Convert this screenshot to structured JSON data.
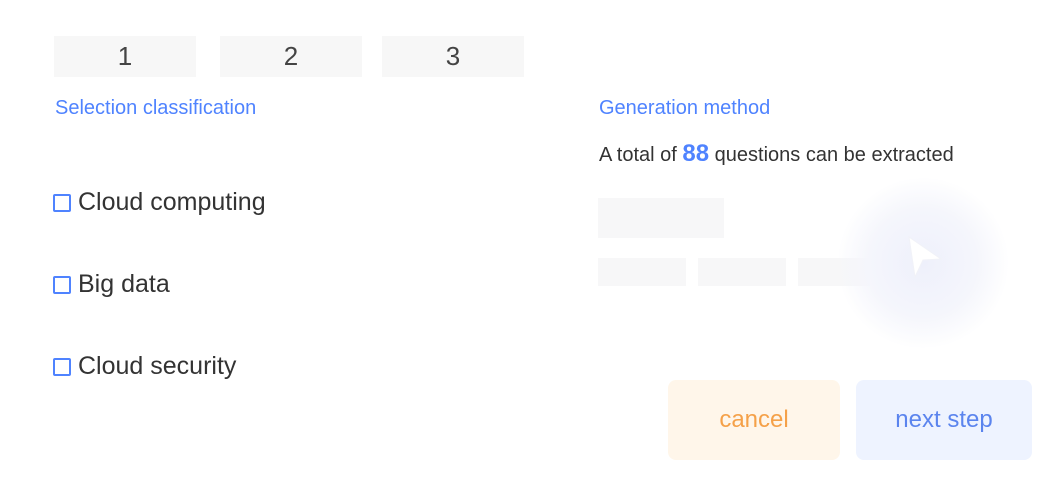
{
  "steps": [
    "1",
    "2",
    "3"
  ],
  "left_panel": {
    "title": "Selection classification",
    "categories": [
      {
        "label": "Cloud computing",
        "checked": false
      },
      {
        "label": "Big data",
        "checked": false
      },
      {
        "label": "Cloud security",
        "checked": false
      }
    ]
  },
  "right_panel": {
    "title": "Generation method",
    "total_prefix": "A total of",
    "total_count": "88",
    "total_suffix": "questions can be extracted"
  },
  "buttons": {
    "cancel": "cancel",
    "next": "next step"
  },
  "colors": {
    "accent": "#4f83ff",
    "cancel_text": "#f5a149",
    "cancel_bg": "#fff6ea",
    "next_text": "#5b84ee",
    "next_bg": "#eef3ff"
  },
  "icons": {
    "checkbox": "checkbox-icon",
    "play": "play-icon"
  }
}
